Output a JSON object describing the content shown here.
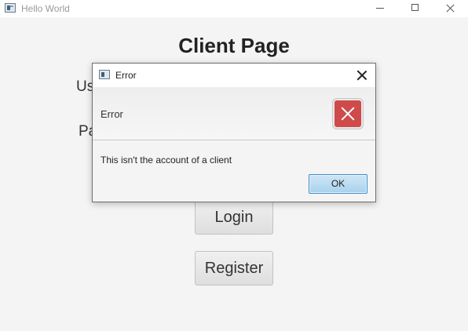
{
  "window": {
    "title": "Hello World",
    "icon": "app-window-icon"
  },
  "main": {
    "title": "Client Page",
    "username_label": "Us",
    "password_label": "Pa",
    "login_label": "Login",
    "register_label": "Register"
  },
  "dialog": {
    "title": "Error",
    "header_text": "Error",
    "icon": "error-x-icon",
    "message": "This isn't the account of a client",
    "ok_label": "OK",
    "colors": {
      "error_icon": "#cf4a4a",
      "ok_border": "#3c8ec7"
    }
  }
}
